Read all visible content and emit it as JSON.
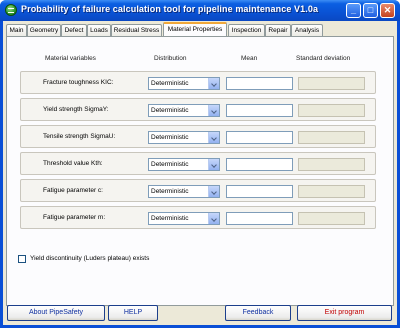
{
  "window": {
    "title": "Probability of failure calculation tool for pipeline maintenance   V1.0a"
  },
  "titlebar_buttons": {
    "minimize": "_",
    "maximize": "□",
    "close": "✕"
  },
  "tabs": [
    {
      "label": "Main"
    },
    {
      "label": "Geometry"
    },
    {
      "label": "Defect"
    },
    {
      "label": "Loads"
    },
    {
      "label": "Residual Stress"
    },
    {
      "label": "Material Properties",
      "active": true
    },
    {
      "label": "Inspection"
    },
    {
      "label": "Repair"
    },
    {
      "label": "Analysis"
    }
  ],
  "headers": {
    "variables": "Material variables",
    "distribution": "Distribution",
    "mean": "Mean",
    "stdev": "Standard deviation"
  },
  "rows": [
    {
      "label": "Fracture toughness KIC:",
      "distribution": "Deterministic",
      "mean": "",
      "stdev": ""
    },
    {
      "label": "Yield strength SigmaY:",
      "distribution": "Deterministic",
      "mean": "",
      "stdev": ""
    },
    {
      "label": "Tensile strength SigmaU:",
      "distribution": "Deterministic",
      "mean": "",
      "stdev": ""
    },
    {
      "label": "Threshold value Kth:",
      "distribution": "Deterministic",
      "mean": "",
      "stdev": ""
    },
    {
      "label": "Fatigue parameter c:",
      "distribution": "Deterministic",
      "mean": "",
      "stdev": ""
    },
    {
      "label": "Fatigue parameter m:",
      "distribution": "Deterministic",
      "mean": "",
      "stdev": ""
    }
  ],
  "checkbox": {
    "label": "Yield discontinuity (Luders plateau) exists",
    "checked": false
  },
  "buttons": {
    "about": "About PipeSafety",
    "help": "HELP",
    "feedback": "Feedback",
    "exit": "Exit program"
  },
  "colors": {
    "titlebar": "#0a52d4",
    "active_tab_accent": "#f0a83a",
    "button_text_blue": "#1030a0",
    "button_text_red": "#c00000"
  }
}
